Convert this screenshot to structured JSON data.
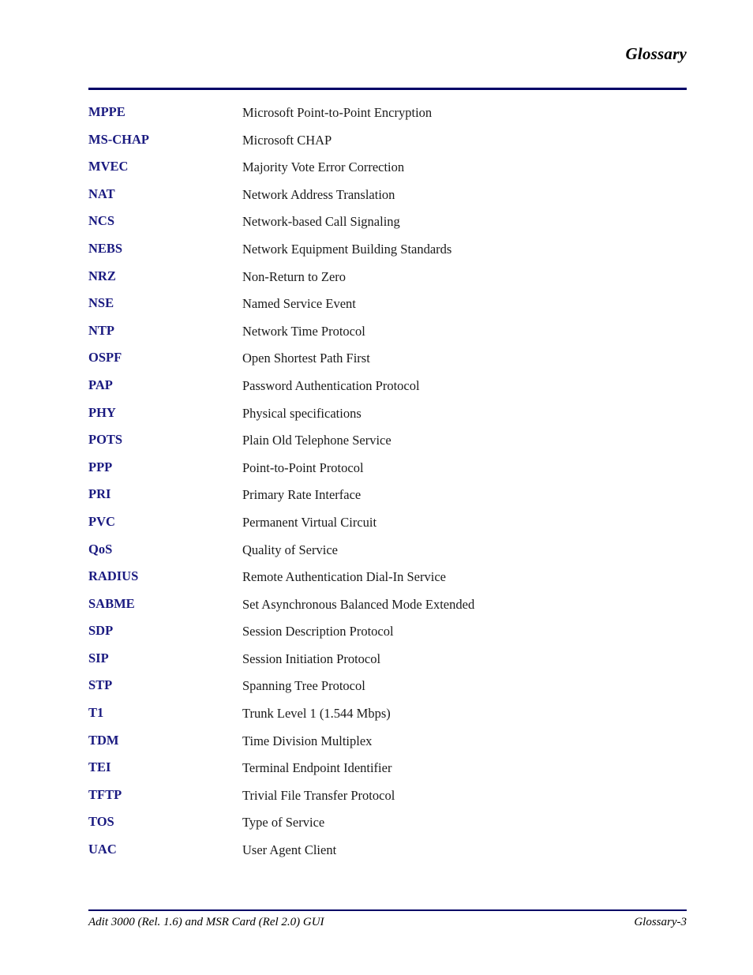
{
  "header": {
    "title": "Glossary",
    "rule_color": "#000066"
  },
  "glossary": {
    "entries": [
      {
        "term": "MPPE",
        "definition": "Microsoft Point-to-Point Encryption"
      },
      {
        "term": "MS-CHAP",
        "definition": "Microsoft CHAP"
      },
      {
        "term": "MVEC",
        "definition": "Majority Vote Error Correction"
      },
      {
        "term": "NAT",
        "definition": "Network Address Translation"
      },
      {
        "term": "NCS",
        "definition": "Network-based Call Signaling"
      },
      {
        "term": "NEBS",
        "definition": "Network Equipment Building Standards"
      },
      {
        "term": "NRZ",
        "definition": "Non-Return to Zero"
      },
      {
        "term": "NSE",
        "definition": "Named Service Event"
      },
      {
        "term": "NTP",
        "definition": "Network Time Protocol"
      },
      {
        "term": "OSPF",
        "definition": "Open Shortest Path First"
      },
      {
        "term": "PAP",
        "definition": "Password Authentication Protocol"
      },
      {
        "term": "PHY",
        "definition": "Physical specifications"
      },
      {
        "term": "POTS",
        "definition": "Plain Old Telephone Service"
      },
      {
        "term": "PPP",
        "definition": "Point-to-Point Protocol"
      },
      {
        "term": "PRI",
        "definition": "Primary Rate Interface"
      },
      {
        "term": "PVC",
        "definition": "Permanent Virtual Circuit"
      },
      {
        "term": "QoS",
        "definition": "Quality of Service"
      },
      {
        "term": "RADIUS",
        "definition": "Remote Authentication Dial-In Service"
      },
      {
        "term": "SABME",
        "definition": "Set Asynchronous Balanced Mode Extended"
      },
      {
        "term": "SDP",
        "definition": "Session Description Protocol"
      },
      {
        "term": "SIP",
        "definition": "Session Initiation Protocol"
      },
      {
        "term": "STP",
        "definition": "Spanning Tree Protocol"
      },
      {
        "term": "T1",
        "definition": "Trunk Level 1 (1.544 Mbps)"
      },
      {
        "term": "TDM",
        "definition": "Time Division Multiplex"
      },
      {
        "term": "TEI",
        "definition": "Terminal Endpoint Identifier"
      },
      {
        "term": "TFTP",
        "definition": "Trivial File Transfer Protocol"
      },
      {
        "term": "TOS",
        "definition": "Type of Service"
      },
      {
        "term": "UAC",
        "definition": "User Agent Client"
      }
    ],
    "term_color": "#1a1a80",
    "definition_color": "#1a1a1a"
  },
  "footer": {
    "left": "Adit 3000 (Rel. 1.6) and MSR Card (Rel 2.0) GUI",
    "right": "Glossary-3",
    "rule_color": "#000066"
  }
}
